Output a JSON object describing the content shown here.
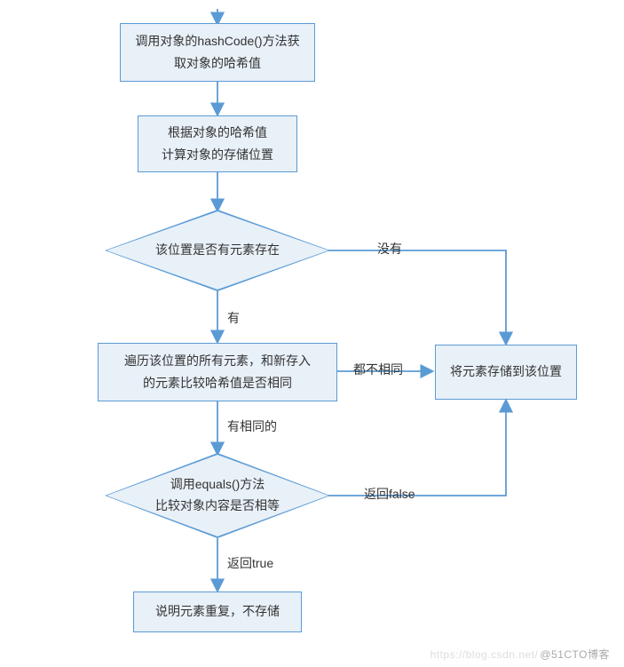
{
  "diagram": {
    "type": "flowchart",
    "nodes": {
      "n1": {
        "line1": "调用对象的hashCode()方法获",
        "line2": "取对象的哈希值"
      },
      "n2": {
        "line1": "根据对象的哈希值",
        "line2": "计算对象的存储位置"
      },
      "n3": {
        "text": "该位置是否有元素存在"
      },
      "n4": {
        "line1": "遍历该位置的所有元素，和新存入",
        "line2": "的元素比较哈希值是否相同"
      },
      "n5": {
        "line1": "调用equals()方法",
        "line2": "比较对象内容是否相等"
      },
      "n6": {
        "text": "说明元素重复，不存储"
      },
      "n7": {
        "text": "将元素存储到该位置"
      }
    },
    "edges": {
      "e_n3_no": "没有",
      "e_n3_yes": "有",
      "e_n4_diff": "都不相同",
      "e_n4_same": "有相同的",
      "e_n5_false": "返回false",
      "e_n5_true": "返回true"
    },
    "colors": {
      "stroke": "#5b9bd5",
      "fill": "#e8f0f8"
    }
  },
  "watermark": {
    "faint": "https://blog.csdn.net/",
    "text": "@51CTO博客"
  }
}
